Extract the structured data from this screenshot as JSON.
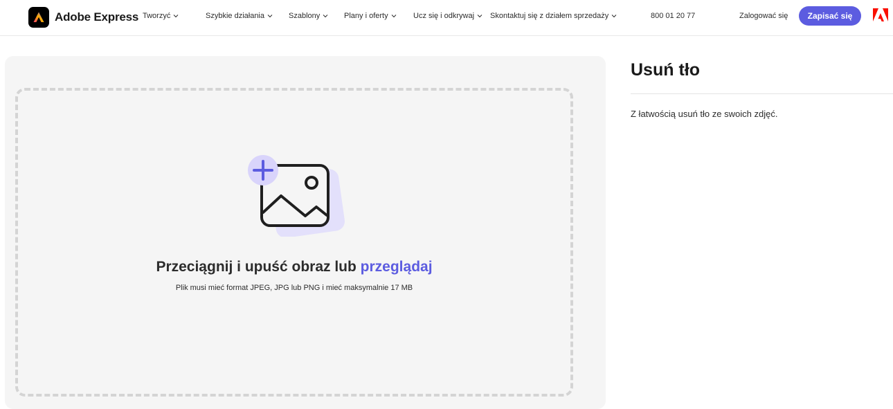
{
  "header": {
    "logo_text": "Adobe Express",
    "nav": [
      {
        "label": "Tworzyć",
        "icon": "chevron-down-icon"
      },
      {
        "label": "Szybkie działania",
        "icon": "chevron-down-icon"
      },
      {
        "label": "Szablony",
        "icon": "chevron-down-icon"
      },
      {
        "label": "Plany i oferty",
        "icon": "chevron-down-icon"
      },
      {
        "label": "Ucz się i odkrywaj",
        "icon": "chevron-down-icon"
      },
      {
        "label": "Skontaktuj się z działem sprzedaży",
        "icon": "chevron-down-icon"
      }
    ],
    "phone": "800 01 20 77",
    "login_label": "Zalogować się",
    "signup_label": "Zapisać się"
  },
  "upload": {
    "title_prefix": "Przeciągnij i upuść obraz lub ",
    "browse_label": "przeglądaj",
    "subtitle": "Plik musi mieć format JPEG, JPG lub PNG i mieć maksymalnie 17 MB"
  },
  "page": {
    "title": "Usuń tło",
    "description": "Z łatwością usuń tło ze swoich zdjęć."
  },
  "colors": {
    "accent": "#5c5ce0",
    "panel_bg": "#f5f5f5",
    "dash": "#d4d4d4",
    "illustration_tint": "#e3e0fb",
    "adobe_red": "#fa0f00"
  }
}
